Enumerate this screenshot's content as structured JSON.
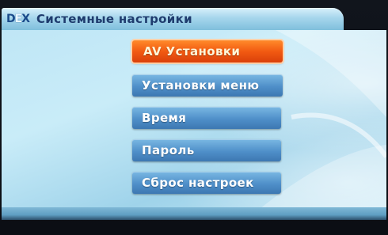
{
  "header": {
    "logo_text": "DEX",
    "title": "Системные настройки"
  },
  "menu": {
    "selected_index": 0,
    "items": [
      {
        "label": "AV Установки"
      },
      {
        "label": "Установки меню"
      },
      {
        "label": "Время"
      },
      {
        "label": "Пароль"
      },
      {
        "label": "Сброс настроек"
      }
    ]
  },
  "colors": {
    "selected": "#f25a12",
    "item": "#4f8fc9",
    "panel": "#bfe6f6",
    "title_text": "#1f3c6e"
  }
}
